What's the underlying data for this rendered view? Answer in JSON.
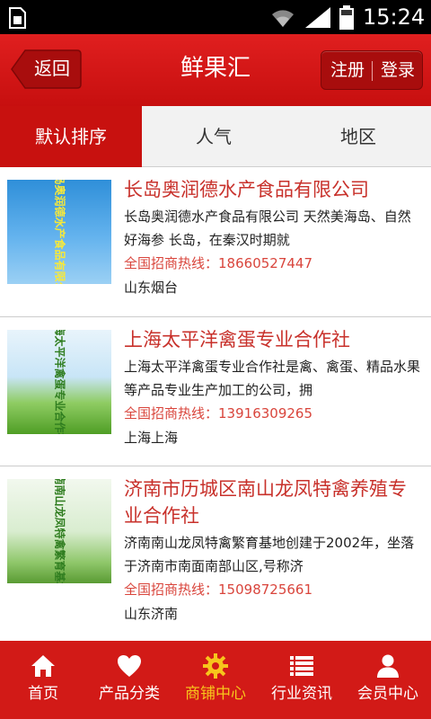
{
  "status_bar": {
    "time": "15:24",
    "icons": [
      "sim-card-icon",
      "wifi-icon",
      "signal-icon",
      "battery-icon"
    ]
  },
  "header": {
    "back_label": "返回",
    "title": "鲜果汇",
    "register_label": "注册",
    "login_label": "登录"
  },
  "tabs": [
    {
      "label": "默认排序",
      "active": true
    },
    {
      "label": "人气",
      "active": false
    },
    {
      "label": "地区",
      "active": false
    }
  ],
  "list": [
    {
      "name": "长岛奥润德水产食品有限公司",
      "desc": "长岛奥润德水产食品有限公司  天然美海岛、自然好海参   长岛，在秦汉时期就",
      "phone_label": "全国招商热线：",
      "phone": "18660527447",
      "location": "山东烟台",
      "thumb_text": "长岛奥润德水产食品有限公司"
    },
    {
      "name": "上海太平洋禽蛋专业合作社",
      "desc": "上海太平洋禽蛋专业合作社是禽、禽蛋、精品水果等产品专业生产加工的公司，拥",
      "phone_label": "全国招商热线：",
      "phone": "13916309265",
      "location": "上海上海",
      "thumb_text": "上海太平洋禽蛋专业合作社"
    },
    {
      "name": "济南市历城区南山龙凤特禽养殖专业合作社",
      "desc": "济南南山龙凤特禽繁育基地创建于2002年，坐落于济南市南面南部山区,号称济",
      "phone_label": "全国招商热线：",
      "phone": "15098725661",
      "location": "山东济南",
      "thumb_text": "济南南山龙凤特禽繁育基地"
    }
  ],
  "bottom_nav": [
    {
      "label": "首页",
      "icon": "home-icon",
      "active": false
    },
    {
      "label": "产品分类",
      "icon": "heart-icon",
      "active": false
    },
    {
      "label": "商铺中心",
      "icon": "gear-icon",
      "active": true
    },
    {
      "label": "行业资讯",
      "icon": "list-icon",
      "active": false
    },
    {
      "label": "会员中心",
      "icon": "user-icon",
      "active": false
    }
  ],
  "colors": {
    "brand_red": "#c8110f",
    "title_red": "#c8312b",
    "nav_active": "#f7c51c"
  }
}
